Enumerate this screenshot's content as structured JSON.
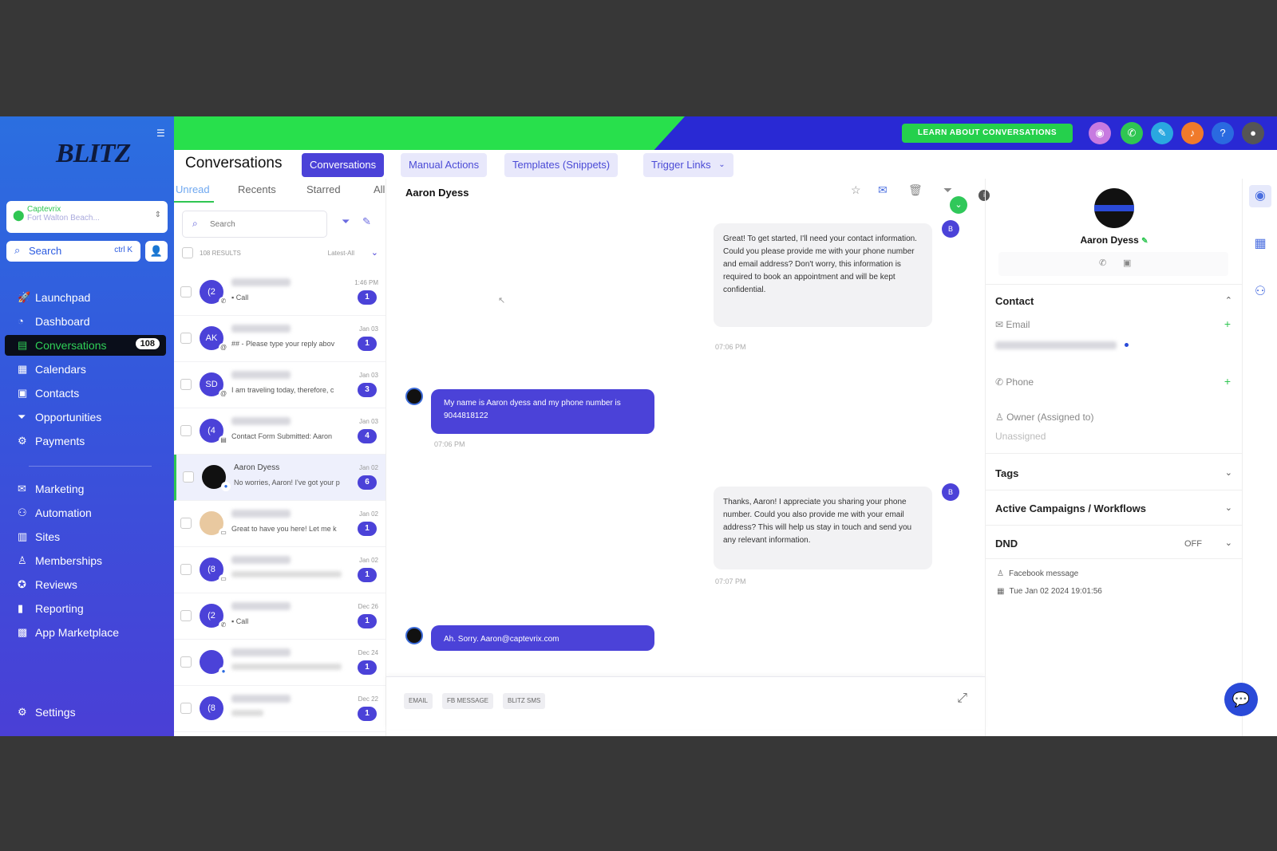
{
  "app": {
    "brand": "BLITZ"
  },
  "sidebar": {
    "location_name": "Captevrix",
    "location_sub": "Fort Walton Beach...",
    "search_label": "Search",
    "search_shortcut": "ctrl K",
    "items": [
      {
        "label": "Launchpad",
        "icon": "rocket-icon"
      },
      {
        "label": "Dashboard",
        "icon": "dashboard-icon"
      },
      {
        "label": "Conversations",
        "icon": "chat-icon",
        "count": "108"
      },
      {
        "label": "Calendars",
        "icon": "calendar-icon"
      },
      {
        "label": "Contacts",
        "icon": "contacts-icon"
      },
      {
        "label": "Opportunities",
        "icon": "funnel-icon"
      },
      {
        "label": "Payments",
        "icon": "payments-icon"
      },
      {
        "label": "Marketing",
        "icon": "megaphone-icon"
      },
      {
        "label": "Automation",
        "icon": "automation-icon"
      },
      {
        "label": "Sites",
        "icon": "sites-icon"
      },
      {
        "label": "Memberships",
        "icon": "memberships-icon"
      },
      {
        "label": "Reviews",
        "icon": "reviews-icon"
      },
      {
        "label": "Reporting",
        "icon": "reporting-icon"
      },
      {
        "label": "App Marketplace",
        "icon": "marketplace-icon"
      }
    ],
    "settings_label": "Settings"
  },
  "topbar": {
    "learn_label": "LEARN ABOUT CONVERSATIONS"
  },
  "header": {
    "title": "Conversations",
    "tabs": [
      "Conversations",
      "Manual Actions",
      "Templates (Snippets)",
      "Trigger Links"
    ]
  },
  "list": {
    "subtabs": [
      "Unread",
      "Recents",
      "Starred",
      "All"
    ],
    "search_placeholder": "Search",
    "results_label": "108 RESULTS",
    "sort_label": "Latest-All",
    "items": [
      {
        "initials": "(2",
        "name": "",
        "preview": "Call",
        "date": "1:46 PM",
        "badge": "1"
      },
      {
        "initials": "AK",
        "name": "",
        "preview": "## - Please type your reply abov",
        "date": "Jan 03",
        "badge": "1"
      },
      {
        "initials": "SD",
        "name": "",
        "preview": "I am traveling today, therefore, c",
        "date": "Jan 03",
        "badge": "3"
      },
      {
        "initials": "(4",
        "name": "",
        "preview": "Contact Form Submitted: Aaron",
        "date": "Jan 03",
        "badge": "4"
      },
      {
        "initials": "",
        "name": "Aaron Dyess",
        "preview": "No worries, Aaron! I've got your p",
        "date": "Jan 02",
        "badge": "6"
      },
      {
        "initials": "",
        "name": "",
        "preview": "Great to have you here! Let me k",
        "date": "Jan 02",
        "badge": "1"
      },
      {
        "initials": "(8",
        "name": "",
        "preview": "",
        "date": "Jan 02",
        "badge": "1"
      },
      {
        "initials": "(2",
        "name": "",
        "preview": "Call",
        "date": "Dec 26",
        "badge": "1"
      },
      {
        "initials": "",
        "name": "",
        "preview": "",
        "date": "Dec 24",
        "badge": "1"
      },
      {
        "initials": "(8",
        "name": "",
        "preview": "",
        "date": "Dec 22",
        "badge": "1"
      }
    ]
  },
  "chat": {
    "contact_name": "Aaron Dyess",
    "messages": [
      {
        "dir": "in",
        "text": "Great! To get started, I'll need your contact information. Could you please provide me with your phone number and email address? Don't worry, this information is required to book an appointment and will be kept confidential.",
        "time": "07:06 PM"
      },
      {
        "dir": "out",
        "text": "My name is Aaron dyess and my phone number is 9044818122",
        "time": "07:06 PM"
      },
      {
        "dir": "in",
        "text": "Thanks, Aaron! I appreciate you sharing your phone number. Could you also provide me with your email address? This will help us stay in touch and send you any relevant information.",
        "time": "07:07 PM"
      },
      {
        "dir": "out",
        "text": "Ah. Sorry. Aaron@captevrix.com",
        "time": ""
      }
    ],
    "composer_tabs": [
      "EMAIL",
      "FB MESSAGE",
      "BLITZ SMS"
    ]
  },
  "contact": {
    "name": "Aaron Dyess",
    "section_contact": "Contact",
    "email_label": "Email",
    "phone_label": "Phone",
    "owner_label": "Owner (Assigned to)",
    "owner_value": "Unassigned",
    "tags_label": "Tags",
    "campaigns_label": "Active Campaigns / Workflows",
    "dnd_label": "DND",
    "dnd_value": "OFF",
    "source": "Facebook message",
    "created": "Tue Jan 02 2024 19:01:56"
  },
  "colors": {
    "brand_blue": "#2a4ad8",
    "accent_purple": "#4b42d8",
    "accent_green": "#2fc652"
  }
}
